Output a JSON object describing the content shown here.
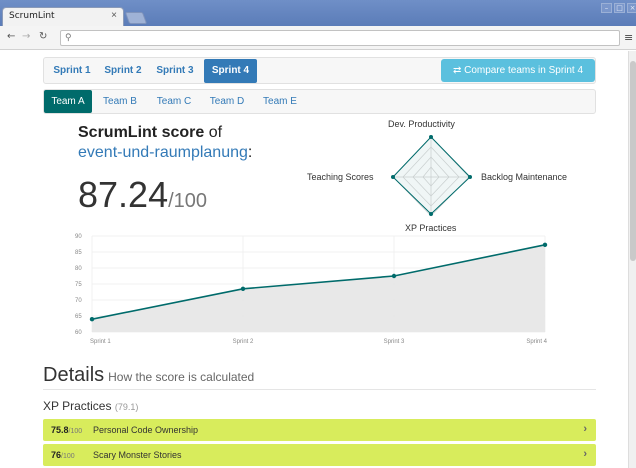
{
  "browser": {
    "tab_title": "ScrumLint",
    "tab_close": "×",
    "back": "←",
    "forward": "→",
    "reload": "↻",
    "search_glyph": "⚲",
    "menu_glyph": "≡",
    "win_min": "–",
    "win_max": "□",
    "win_close": "×"
  },
  "sprint_nav": {
    "tabs": [
      "Sprint 1",
      "Sprint 2",
      "Sprint 3",
      "Sprint 4"
    ],
    "active": "Sprint 4",
    "compare_icon": "⇄",
    "compare_label": "Compare teams in Sprint 4"
  },
  "team_nav": {
    "tabs": [
      "Team A",
      "Team B",
      "Team C",
      "Team D",
      "Team E"
    ],
    "active": "Team A"
  },
  "score": {
    "title_bold": "ScrumLint score",
    "title_rest": " of",
    "project": "event-und-raumplanung",
    "colon": ":",
    "value": "87.24",
    "max": "/100"
  },
  "radar": {
    "labels": [
      "Dev. Productivity",
      "Backlog Maintenance",
      "XP Practices",
      "Teaching Scores"
    ],
    "color": "#006b6b"
  },
  "line_chart": {
    "y_ticks": [
      "90",
      "85",
      "80",
      "75",
      "70",
      "65",
      "60"
    ],
    "x_labels": [
      "Sprint 1",
      "Sprint 2",
      "Sprint 3",
      "Sprint 4"
    ],
    "color": "#006b6b",
    "fill": "#e6e6e6"
  },
  "chart_data": {
    "type": "line",
    "categories": [
      "Sprint 1",
      "Sprint 2",
      "Sprint 3",
      "Sprint 4"
    ],
    "series": [
      {
        "values": [
          64,
          73.5,
          77.5,
          87.24
        ]
      }
    ],
    "xlabel": "",
    "ylabel": "",
    "ylim": [
      60,
      90
    ],
    "grid": true
  },
  "details": {
    "title": "Details",
    "subtitle": "How the score is calculated",
    "category_name": "XP Practices",
    "category_score": "(79.1)",
    "items": [
      {
        "score": "75.8",
        "max": "/100",
        "label": "Personal Code Ownership",
        "chevron": "›"
      },
      {
        "score": "76",
        "max": "/100",
        "label": "Scary Monster Stories",
        "chevron": "›"
      }
    ],
    "item_color": "#d8ec5c"
  }
}
